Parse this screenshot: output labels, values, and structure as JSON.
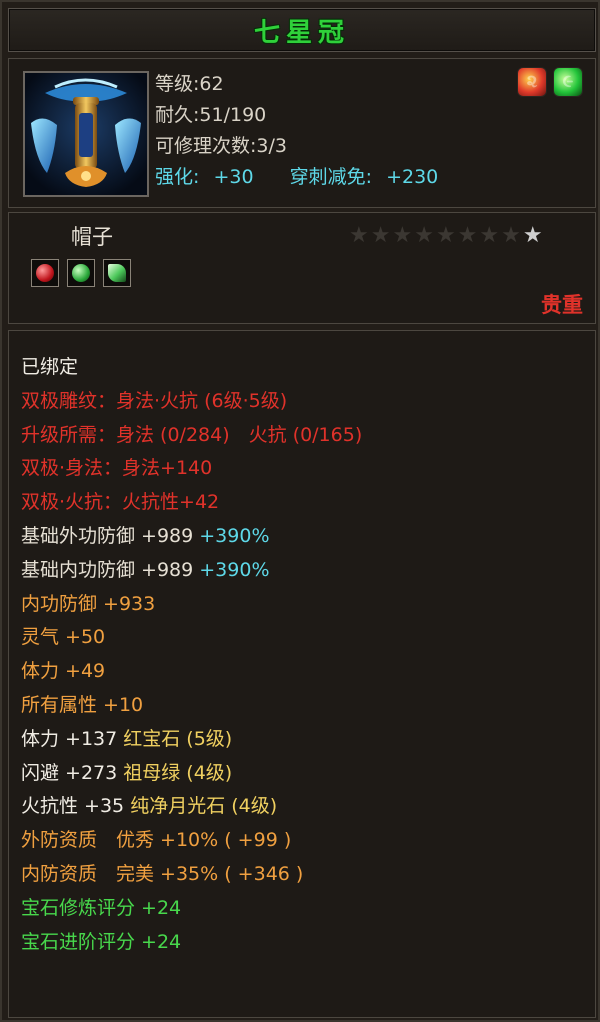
{
  "title": "七星冠",
  "item": {
    "level_label": "等级:62",
    "durability_label": "耐久:51/190",
    "repair_label": "可修理次数:3/3",
    "enhance_label": "强化:",
    "enhance_value": "+30",
    "pierce_label": "穿刺减免:",
    "pierce_value": "+230",
    "type": "帽子",
    "rarity": "贵重",
    "stars_total": 9,
    "stars_lit": 1
  },
  "attributes": {
    "bound": "已绑定",
    "line1": "双极雕纹：身法·火抗 (6级·5级)",
    "line2": "升级所需：身法 (0/284)　火抗 (0/165)",
    "line3": "双极·身法：身法+140",
    "line4": "双极·火抗：火抗性+42",
    "line5_a": "基础外功防御 +989 ",
    "line5_b": "+390%",
    "line6_a": "基础内功防御 +989 ",
    "line6_b": "+390%",
    "line7": "内功防御 +933",
    "line8": "灵气 +50",
    "line9": "体力 +49",
    "line10": "所有属性 +10",
    "line11_a": "体力 +137 ",
    "line11_b": "红宝石 (5级)",
    "line12_a": "闪避 +273 ",
    "line12_b": "祖母绿 (4级)",
    "line13_a": "火抗性 +35 ",
    "line13_b": "纯净月光石 (4级)",
    "line14": "外防资质　优秀 +10% ( +99 )",
    "line15": "内防资质　完美 +35% ( +346 )",
    "line16": "宝石修炼评分 +24",
    "line17": "宝石进阶评分 +24"
  },
  "colors": {
    "title": "#2fd13a",
    "red": "#e0322a",
    "cyan": "#5ed8e8",
    "orange": "#f0a040",
    "green": "#48d84c",
    "gold": "#f0d060"
  }
}
